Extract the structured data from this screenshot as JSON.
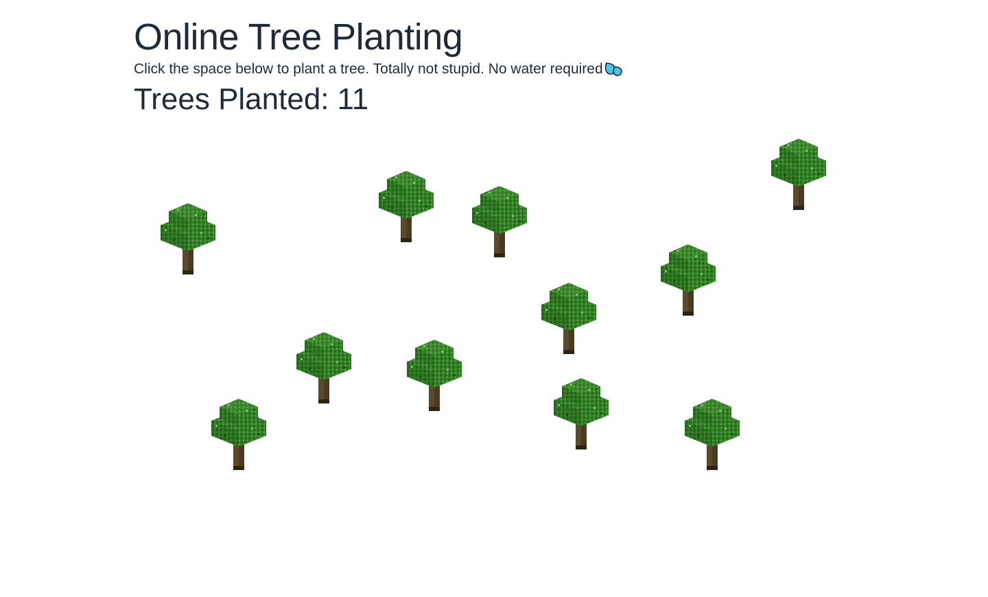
{
  "header": {
    "title": "Online Tree Planting",
    "subtitle": "Click the space below to plant a tree. Totally not stupid. No water required",
    "water_icon": "water-droplets-icon",
    "counter_label": "Trees Planted:",
    "counter_value": "11"
  },
  "colors": {
    "text": "#1c2b3a",
    "leaves_dark": "#1f5a16",
    "leaves_mid": "#2f7d22",
    "leaves_light": "#5ea84a",
    "trunk": "#4a3a22",
    "water": "#4cc3e0"
  },
  "field": {
    "tree_count": 11,
    "tree_icon": "tree-icon"
  }
}
